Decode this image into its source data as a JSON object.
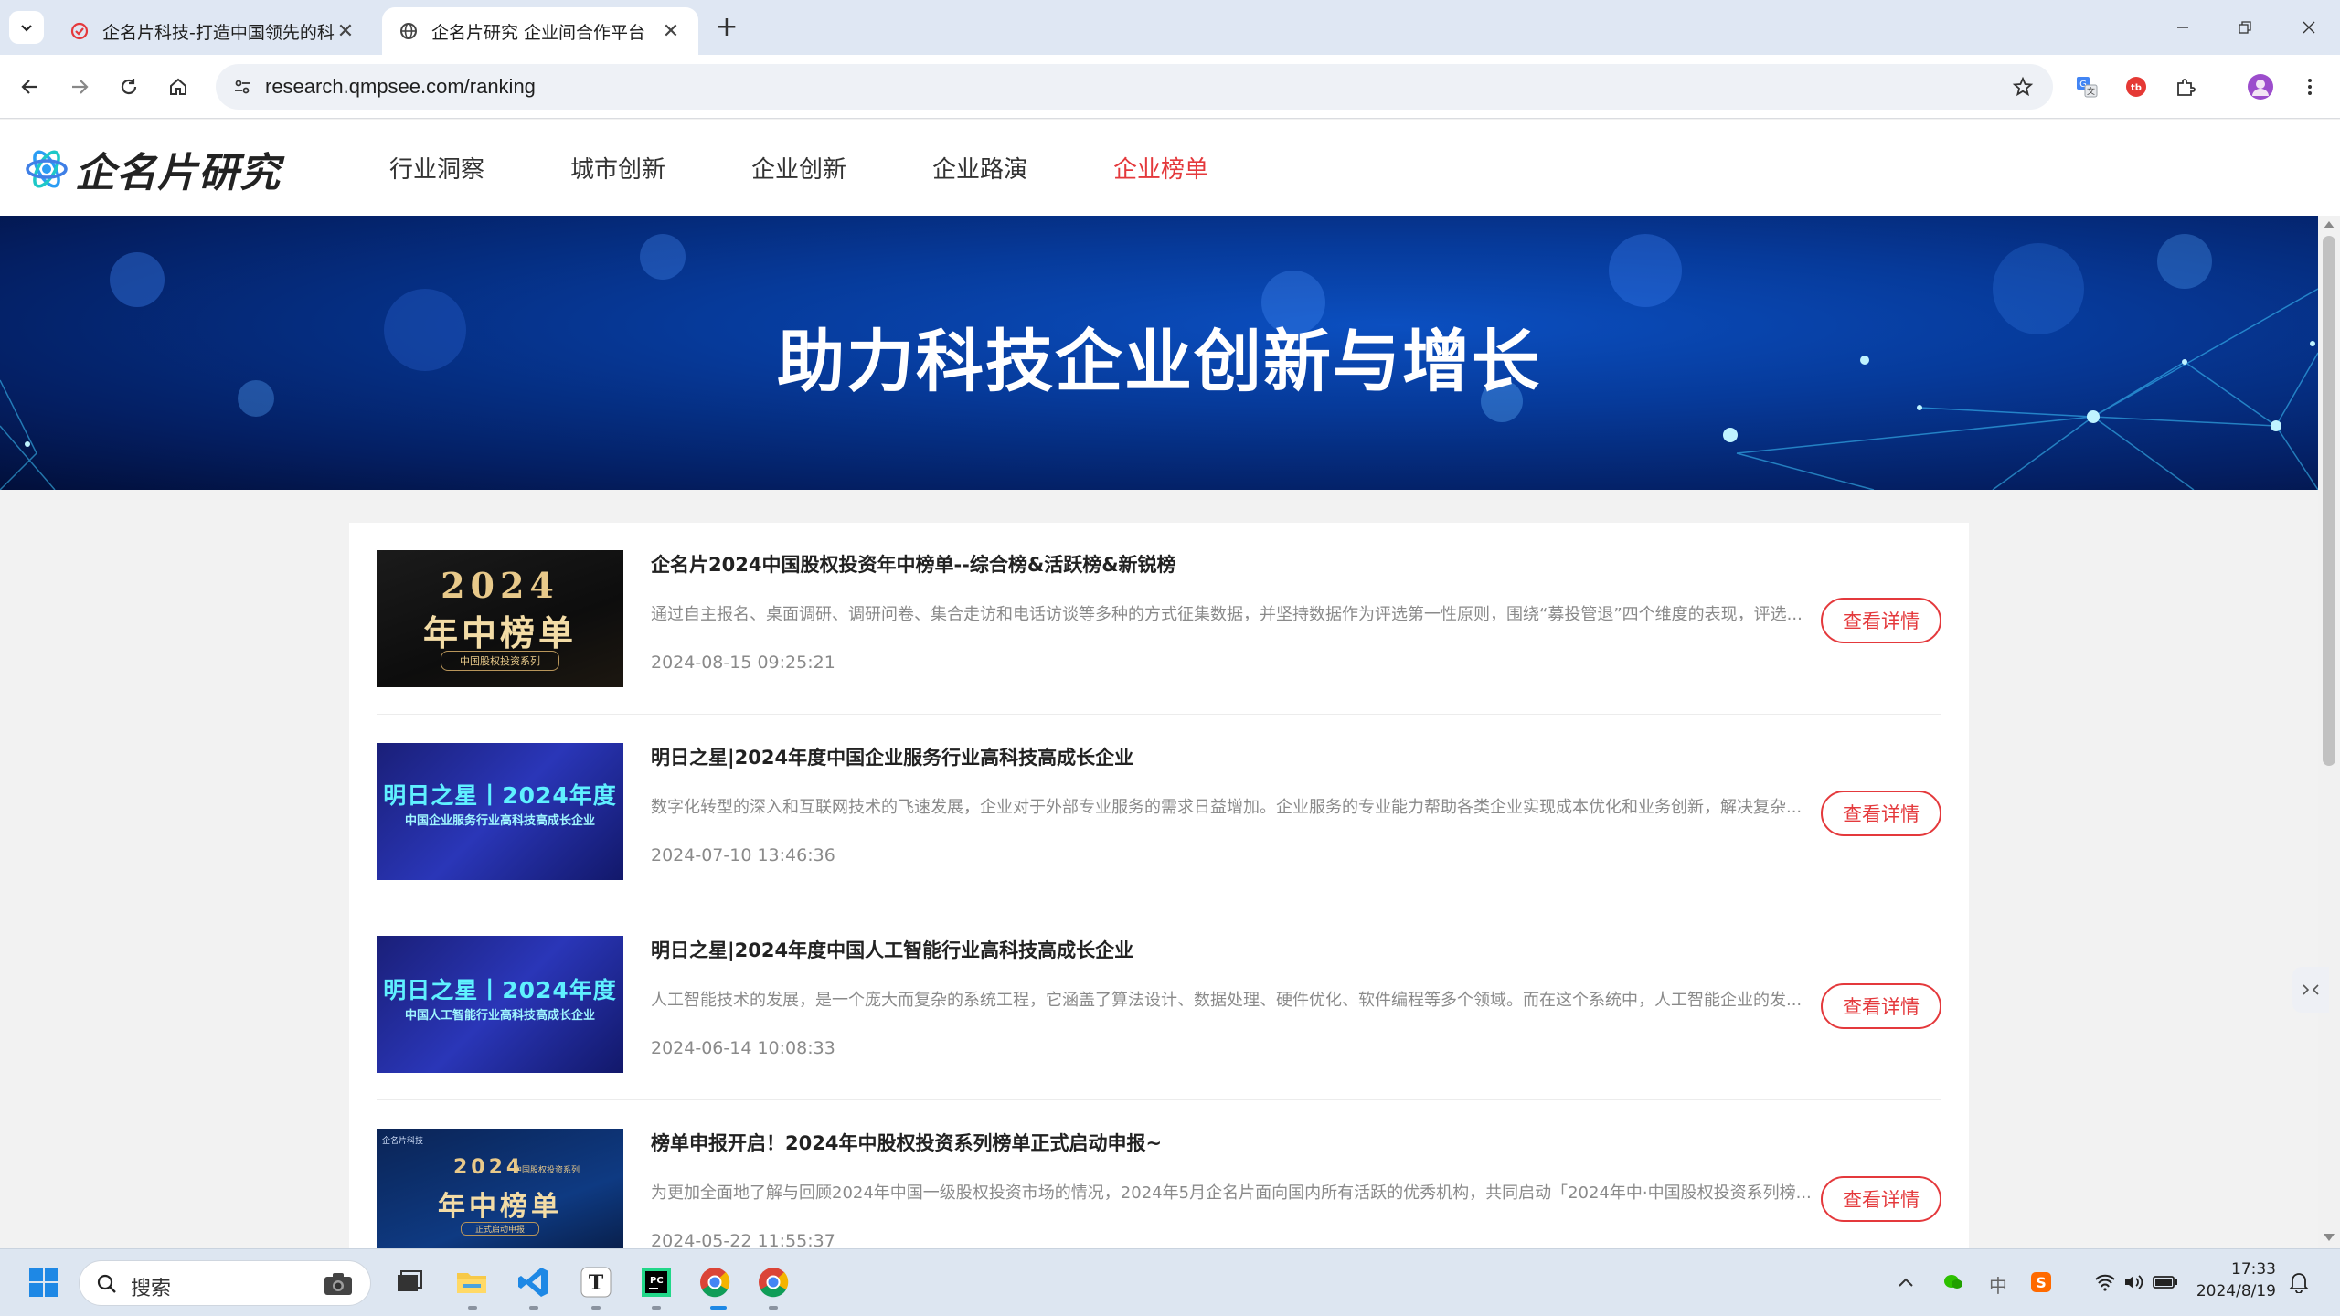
{
  "browser": {
    "tabs": [
      {
        "title": "企名片科技-打造中国领先的科技",
        "active": false
      },
      {
        "title": "企名片研究 企业间合作平台",
        "active": true
      }
    ],
    "address": "research.qmpsee.com/ranking"
  },
  "site": {
    "logo_text": "企名片研究",
    "nav": [
      "行业洞察",
      "城市创新",
      "企业创新",
      "企业路演",
      "企业榜单"
    ],
    "active_nav": "企业榜单",
    "banner_title": "助力科技企业创新与增长",
    "items": [
      {
        "title": "企名片2024中国股权投资年中榜单--综合榜&活跃榜&新锐榜",
        "desc": "通过自主报名、桌面调研、调研问卷、集合走访和电话访谈等多种的方式征集数据，并坚持数据作为评选第一性原则，围绕“募投管退”四个维度的表现，评选...",
        "date": "2024-08-15 09:25:21",
        "button": "查看详情",
        "thumb": {
          "line1": "2024",
          "line2": "年中榜单",
          "line3": "中国股权投资系列"
        }
      },
      {
        "title": "明日之星|2024年度中国企业服务行业高科技高成长企业",
        "desc": "数字化转型的深入和互联网技术的飞速发展，企业对于外部专业服务的需求日益增加。企业服务的专业能力帮助各类企业实现成本优化和业务创新，解决复杂...",
        "date": "2024-07-10 13:46:36",
        "button": "查看详情",
        "thumb": {
          "line1": "明日之星丨2024年度",
          "line2": "中国企业服务行业高科技高成长企业"
        }
      },
      {
        "title": "明日之星|2024年度中国人工智能行业高科技高成长企业",
        "desc": "人工智能技术的发展，是一个庞大而复杂的系统工程，它涵盖了算法设计、数据处理、硬件优化、软件编程等多个领域。而在这个系统中，人工智能企业的发...",
        "date": "2024-06-14 10:08:33",
        "button": "查看详情",
        "thumb": {
          "line1": "明日之星丨2024年度",
          "line2": "中国人工智能行业高科技高成长企业"
        }
      },
      {
        "title": "榜单申报开启！2024年中股权投资系列榜单正式启动申报~",
        "desc": "为更加全面地了解与回顾2024年中国一级股权投资市场的情况，2024年5月企名片面向国内所有活跃的优秀机构，共同启动「2024年中·中国股权投资系列榜...",
        "date": "2024-05-22 11:55:37",
        "button": "查看详情",
        "thumb": {
          "line0": "企名片科技",
          "line1": "2024",
          "line1b": "中国股权投资系列",
          "line2": "年中榜单",
          "line3": "正式启动申报"
        }
      }
    ]
  },
  "taskbar": {
    "search_placeholder": "搜索",
    "ime": "中",
    "time": "17:33",
    "date": "2024/8/19"
  },
  "colors": {
    "accent": "#e4393c",
    "banner": "#063a9a",
    "tabstrip": "#dfe7f3"
  }
}
